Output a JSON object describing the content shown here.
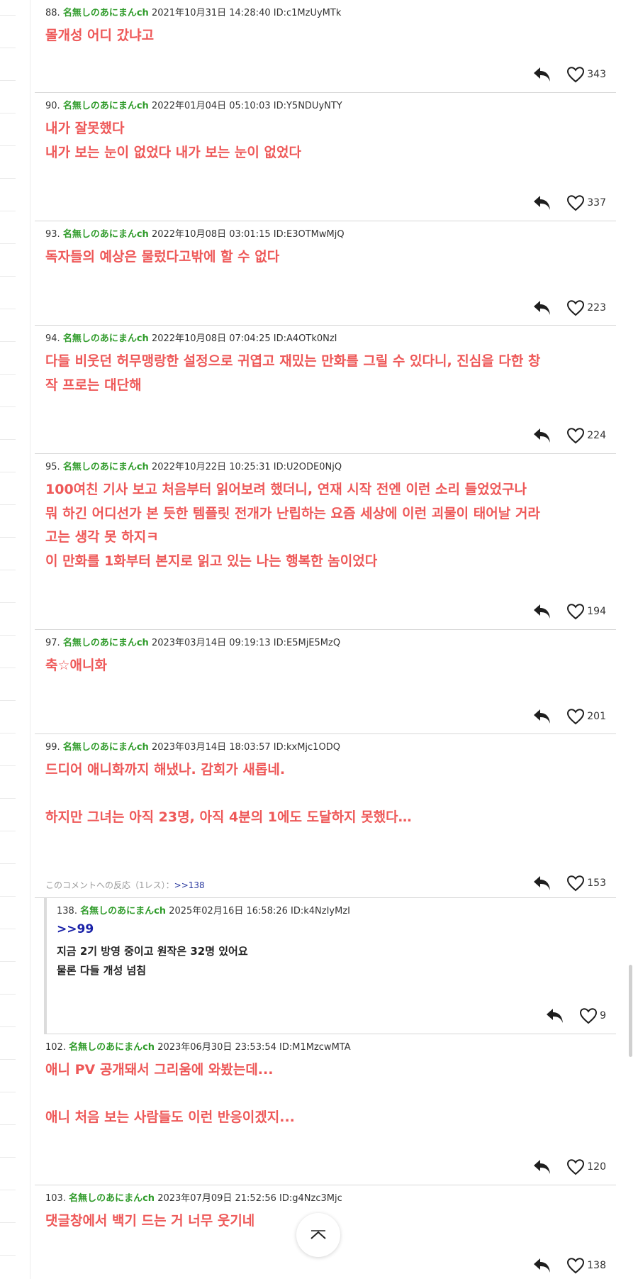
{
  "comments": [
    {
      "num": "88.",
      "name": "名無しのあにまんch",
      "date": "2021年10月31日 14:28:40",
      "id": "ID:c1MzUyMTk",
      "lines": [
        "몰개성 어디 갔냐고"
      ],
      "likes": "343"
    },
    {
      "num": "90.",
      "name": "名無しのあにまんch",
      "date": "2022年01月04日 05:10:03",
      "id": "ID:Y5NDUyNTY",
      "lines": [
        "내가 잘못했다",
        "내가 보는 눈이 없었다 내가 보는 눈이 없었다"
      ],
      "likes": "337"
    },
    {
      "num": "93.",
      "name": "名無しのあにまんch",
      "date": "2022年10月08日 03:01:15",
      "id": "ID:E3OTMwMjQ",
      "lines": [
        "독자들의 예상은 물렀다고밖에 할 수 없다"
      ],
      "likes": "223"
    },
    {
      "num": "94.",
      "name": "名無しのあにまんch",
      "date": "2022年10月08日 07:04:25",
      "id": "ID:A4OTk0NzI",
      "lines": [
        "다들 비웃던 허무맹랑한 설정으로 귀엽고 재밌는 만화를 그릴 수 있다니, 진심을 다한 창",
        "작 프로는 대단해"
      ],
      "likes": "224"
    },
    {
      "num": "95.",
      "name": "名無しのあにまんch",
      "date": "2022年10月22日 10:25:31",
      "id": "ID:U2ODE0NjQ",
      "lines": [
        "100여친 기사 보고 처음부터 읽어보려 했더니, 연재 시작 전엔 이런 소리 들었었구나",
        "뭐 하긴 어디선가 본 듯한 템플릿 전개가 난립하는 요즘 세상에 이런 괴물이 태어날 거라",
        "고는 생각 못 하지ㅋ",
        "이 만화를 1화부터 본지로 읽고 있는 나는 행복한 놈이었다"
      ],
      "likes": "194"
    },
    {
      "num": "97.",
      "name": "名無しのあにまんch",
      "date": "2023年03月14日 09:19:13",
      "id": "ID:E5MjE5MzQ",
      "lines": [
        "축☆애니화"
      ],
      "likes": "201"
    },
    {
      "num": "99.",
      "name": "名無しのあにまんch",
      "date": "2023年03月14日 18:03:57",
      "id": "ID:kxMjc1ODQ",
      "lines": [
        "드디어 애니화까지 해냈나. 감회가 새롭네.",
        "",
        "하지만 그녀는 아직 23명, 아직 4분의 1에도 도달하지 못했다…"
      ],
      "likes": "153",
      "reaction": {
        "label": "このコメントへの反応（1レス）：",
        "anchor": ">>138"
      }
    }
  ],
  "reply": {
    "num": "138.",
    "name": "名無しのあにまんch",
    "date": "2025年02月16日 16:58:26",
    "id": "ID:k4NzIyMzI",
    "anchor": ">>99",
    "lines": [
      "지금 2기 방영 중이고 원작은 32명 있어요",
      "물론 다들 개성 넘침"
    ],
    "likes": "9"
  },
  "comments_after": [
    {
      "num": "102.",
      "name": "名無しのあにまんch",
      "date": "2023年06月30日 23:53:54",
      "id": "ID:M1MzcwMTA",
      "lines": [
        "애니 PV 공개돼서 그리움에 와봤는데...",
        "",
        "애니 처음 보는 사람들도 이런 반응이겠지..."
      ],
      "likes": "120"
    },
    {
      "num": "103.",
      "name": "名無しのあにまんch",
      "date": "2023年07月09日 21:52:56",
      "id": "ID:g4Nzc3Mjc",
      "lines": [
        "댓글창에서 백기 드는 거 너무 웃기네"
      ],
      "likes": "138"
    }
  ],
  "icons": {
    "reply": "reply-arrow-icon",
    "like": "heart-icon",
    "scroll_top": "chevron-up-icon"
  },
  "colors": {
    "name": "#2f9b2a",
    "body": "#ee5858",
    "anchor": "#1a22a8",
    "reaction_anchor": "#2b3a9f"
  }
}
